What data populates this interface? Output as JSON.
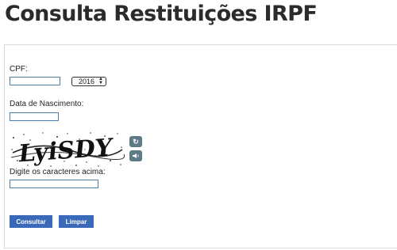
{
  "page": {
    "title": "Consulta Restituições IRPF"
  },
  "form": {
    "cpf_label": "CPF:",
    "cpf_value": "",
    "year_selected": "2016",
    "dob_label": "Data de Nascimento:",
    "dob_value": "",
    "captcha_text": "LyiSDY",
    "captcha_prompt": "Digite os caracteres acima:",
    "captcha_value": ""
  },
  "actions": {
    "consultar_label": "Consultar",
    "limpar_label": "Limpar"
  },
  "icons": {
    "refresh": "refresh-icon",
    "audio": "speaker-icon"
  },
  "colors": {
    "primary_button": "#3b69b9",
    "captcha_button": "#5d7a86",
    "input_border": "#4a7fb0"
  }
}
